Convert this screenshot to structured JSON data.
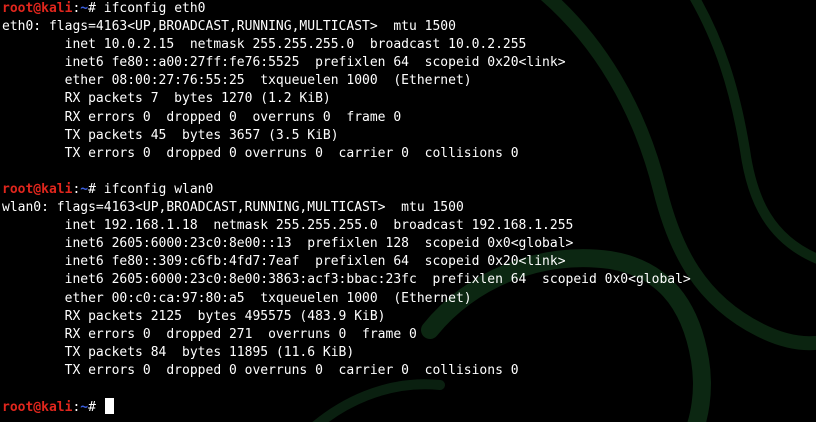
{
  "colors": {
    "background": "#000000",
    "text": "#ffffff",
    "prompt_user": "#e0261d",
    "prompt_path": "#3b5fe0",
    "watermark": "#0d2a12"
  },
  "terminal": {
    "blocks": [
      {
        "prompt": {
          "user_host": "root@kali",
          "sep": ":",
          "path": "~",
          "symbol": "#",
          "command": "ifconfig eth0"
        },
        "output": [
          "eth0: flags=4163<UP,BROADCAST,RUNNING,MULTICAST>  mtu 1500",
          "        inet 10.0.2.15  netmask 255.255.255.0  broadcast 10.0.2.255",
          "        inet6 fe80::a00:27ff:fe76:5525  prefixlen 64  scopeid 0x20<link>",
          "        ether 08:00:27:76:55:25  txqueuelen 1000  (Ethernet)",
          "        RX packets 7  bytes 1270 (1.2 KiB)",
          "        RX errors 0  dropped 0  overruns 0  frame 0",
          "        TX packets 45  bytes 3657 (3.5 KiB)",
          "        TX errors 0  dropped 0 overruns 0  carrier 0  collisions 0",
          ""
        ]
      },
      {
        "prompt": {
          "user_host": "root@kali",
          "sep": ":",
          "path": "~",
          "symbol": "#",
          "command": "ifconfig wlan0"
        },
        "output": [
          "wlan0: flags=4163<UP,BROADCAST,RUNNING,MULTICAST>  mtu 1500",
          "        inet 192.168.1.18  netmask 255.255.255.0  broadcast 192.168.1.255",
          "        inet6 2605:6000:23c0:8e00::13  prefixlen 128  scopeid 0x0<global>",
          "        inet6 fe80::309:c6fb:4fd7:7eaf  prefixlen 64  scopeid 0x20<link>",
          "        inet6 2605:6000:23c0:8e00:3863:acf3:bbac:23fc  prefixlen 64  scopeid 0x0<global>",
          "        ether 00:c0:ca:97:80:a5  txqueuelen 1000  (Ethernet)",
          "        RX packets 2125  bytes 495575 (483.9 KiB)",
          "        RX errors 0  dropped 271  overruns 0  frame 0",
          "        TX packets 84  bytes 11895 (11.6 KiB)",
          "        TX errors 0  dropped 0 overruns 0  carrier 0  collisions 0",
          ""
        ]
      }
    ],
    "final_prompt": {
      "user_host": "root@kali",
      "sep": ":",
      "path": "~",
      "symbol": "#",
      "command": ""
    }
  }
}
